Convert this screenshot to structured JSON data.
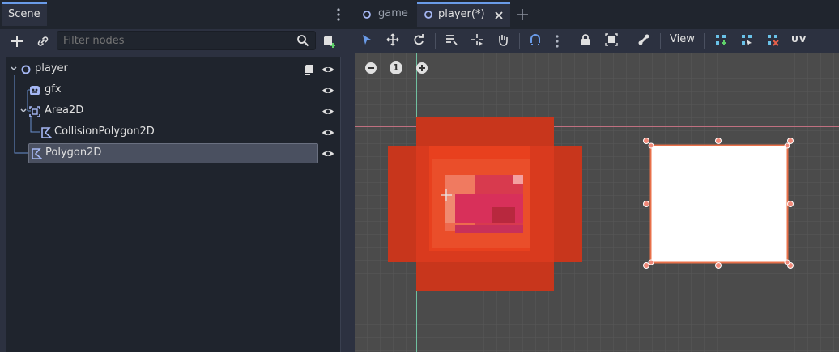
{
  "scene_dock": {
    "tab_label": "Scene",
    "filter": {
      "placeholder": "Filter nodes",
      "value": ""
    },
    "tree": [
      {
        "name": "player",
        "icon": "node2d-circle-icon",
        "depth": 0,
        "expanded": true,
        "has_script": true,
        "selected": false
      },
      {
        "name": "gfx",
        "icon": "sprite-icon",
        "depth": 1,
        "expanded": false,
        "has_script": false,
        "selected": false
      },
      {
        "name": "Area2D",
        "icon": "area2d-icon",
        "depth": 1,
        "expanded": true,
        "has_script": false,
        "selected": false
      },
      {
        "name": "CollisionPolygon2D",
        "icon": "polygon-icon",
        "depth": 2,
        "expanded": false,
        "has_script": false,
        "selected": false
      },
      {
        "name": "Polygon2D",
        "icon": "polygon-icon",
        "depth": 1,
        "expanded": false,
        "has_script": false,
        "selected": true
      }
    ]
  },
  "editor_tabs": {
    "tabs": [
      {
        "label": "game",
        "active": false
      },
      {
        "label": "player(*)",
        "active": true
      }
    ]
  },
  "editor_toolbar": {
    "view_label": "View",
    "uv_label": "UV"
  },
  "zoom_controls": {
    "reset_label": "1"
  },
  "colors": {
    "accent": "#6a9be8",
    "selection_handle": "#f07a6a",
    "sprite_red": "#e8401e"
  }
}
